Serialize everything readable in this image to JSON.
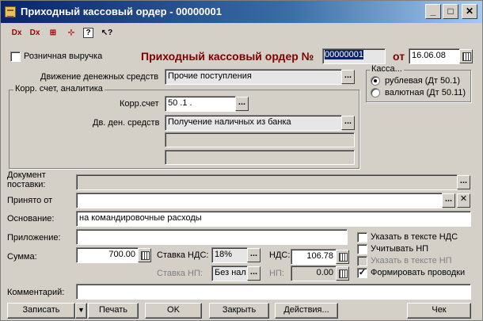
{
  "window": {
    "title": "Приходный кассовый ордер - 00000001"
  },
  "toolbar": {
    "icons": [
      "doc-delete-icon",
      "delete-icon",
      "doc-add-icon",
      "doc-structure-icon",
      "help-icon",
      "help-arrow-icon"
    ]
  },
  "header": {
    "retail_label": "Розничная выручка",
    "doc_title": "Приходный кассовый ордер №",
    "number": "00000001",
    "from_label": "от",
    "date": "16.06.08"
  },
  "cash": {
    "legend": "Касса...",
    "options": [
      "рублевая (Дт 50.1)",
      "валютная (Дт 50.11)"
    ],
    "selected": 0
  },
  "fields": {
    "movement_label": "Движение денежных средств",
    "movement_value": "Прочие поступления",
    "corr_legend": "Корр. счет, аналитика",
    "corr_label": "Корр.счет",
    "corr_value": "50 .1 .",
    "dds_label": "Дв. ден. средств",
    "dds_value": "Получение наличных из банка",
    "supply_doc_label": "Документ поставки:",
    "supply_doc_value": "",
    "accepted_label": "Принято от",
    "accepted_value": "",
    "basis_label": "Основание:",
    "basis_value": "на командировочные расходы",
    "attachment_label": "Приложение:",
    "attachment_value": "",
    "sum_label": "Сумма:",
    "sum_value": "700.00",
    "vat_rate_label": "Ставка НДС:",
    "vat_rate_value": "18%",
    "vat_label": "НДС:",
    "vat_value": "106.78",
    "np_rate_label": "Ставка НП:",
    "np_rate_value": "Без нал",
    "np_label": "НП:",
    "np_value": "0.00",
    "comment_label": "Комментарий:",
    "comment_value": ""
  },
  "checks": {
    "vat_in_text": {
      "label": "Указать в тексте НДС",
      "checked": false
    },
    "account_np": {
      "label": "Учитывать НП",
      "checked": false
    },
    "np_in_text": {
      "label": "Указать в тексте НП",
      "checked": false
    },
    "make_entries": {
      "label": "Формировать проводки",
      "checked": true
    }
  },
  "buttons": {
    "save": "Записать",
    "print": "Печать",
    "ok": "OK",
    "close": "Закрыть",
    "actions": "Действия...",
    "check": "Чек"
  }
}
